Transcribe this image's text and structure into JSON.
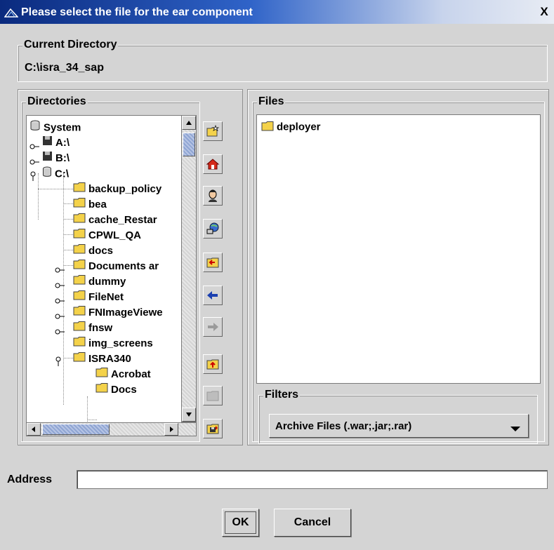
{
  "window": {
    "title": "Please select the file for the ear component",
    "close_glyph": "X"
  },
  "current_directory": {
    "label": "Current Directory",
    "path": "C:\\isra_34_sap"
  },
  "directories": {
    "label": "Directories",
    "tree": [
      {
        "label": "System",
        "icon": "database-icon",
        "level": 0
      },
      {
        "label": "A:\\",
        "icon": "floppy-disk-icon",
        "level": 0
      },
      {
        "label": "B:\\",
        "icon": "floppy-disk-icon",
        "level": 0
      },
      {
        "label": "C:\\",
        "icon": "drive-icon",
        "level": 0
      },
      {
        "label": "backup_policy",
        "icon": "folder-icon",
        "level": 1
      },
      {
        "label": "bea",
        "icon": "folder-icon",
        "level": 1
      },
      {
        "label": "cache_Restar",
        "icon": "folder-icon",
        "level": 1
      },
      {
        "label": "CPWL_QA",
        "icon": "folder-icon",
        "level": 1
      },
      {
        "label": "docs",
        "icon": "folder-icon",
        "level": 1
      },
      {
        "label": "Documents ar",
        "icon": "folder-icon",
        "level": 1
      },
      {
        "label": "dummy",
        "icon": "folder-icon",
        "level": 1
      },
      {
        "label": "FileNet",
        "icon": "folder-icon",
        "level": 1
      },
      {
        "label": "FNImageViewe",
        "icon": "folder-icon",
        "level": 1
      },
      {
        "label": "fnsw",
        "icon": "folder-icon",
        "level": 1
      },
      {
        "label": "img_screens",
        "icon": "folder-icon",
        "level": 1
      },
      {
        "label": "ISRA340",
        "icon": "folder-icon",
        "level": 1
      },
      {
        "label": "Acrobat",
        "icon": "folder-icon",
        "level": 2
      },
      {
        "label": "Docs",
        "icon": "folder-icon",
        "level": 2
      }
    ]
  },
  "toolbar": {
    "buttons": [
      "new-folder-icon",
      "home-icon",
      "user-profile-icon",
      "network-icon",
      "return-folder-icon",
      "back-arrow-icon",
      "forward-arrow-icon",
      "parent-folder-icon",
      "disabled-folder-icon",
      "save-folder-icon"
    ]
  },
  "files": {
    "label": "Files",
    "items": [
      {
        "label": "deployer",
        "icon": "folder-icon"
      }
    ]
  },
  "filters": {
    "label": "Filters",
    "selected": "Archive Files (.war;.jar;.rar)"
  },
  "address": {
    "label": "Address",
    "value": ""
  },
  "buttons": {
    "ok": "OK",
    "cancel": "Cancel"
  },
  "colors": {
    "title_start": "#0a2a7e",
    "title_end": "#e8ecf4",
    "dialog_bg": "#d4d4d4",
    "folder": "#f4d24a",
    "scroll_thumb": "#9fb2da"
  }
}
